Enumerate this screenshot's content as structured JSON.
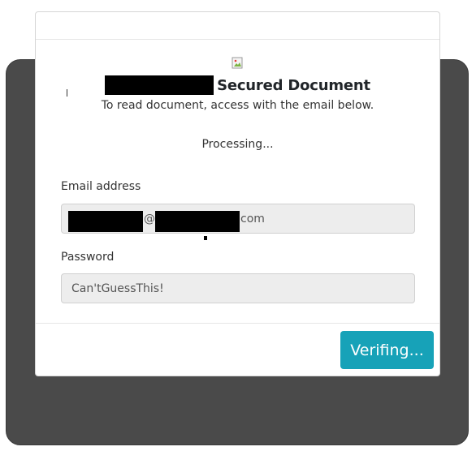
{
  "dialog": {
    "title": "Secured Document",
    "subtitle": "To read document, access with the email below.",
    "status": "Processing..."
  },
  "form": {
    "email_label": "Email address",
    "email_at": "@",
    "email_tld": "com",
    "password_label": "Password",
    "password_value": "Can'tGuessThis!"
  },
  "footer": {
    "button_label": "Verifing..."
  },
  "colors": {
    "accent": "#17a2b8",
    "backdrop": "#4a4a4a",
    "field_bg": "#ededed"
  },
  "icons": {
    "broken_image": "broken-image-icon"
  }
}
